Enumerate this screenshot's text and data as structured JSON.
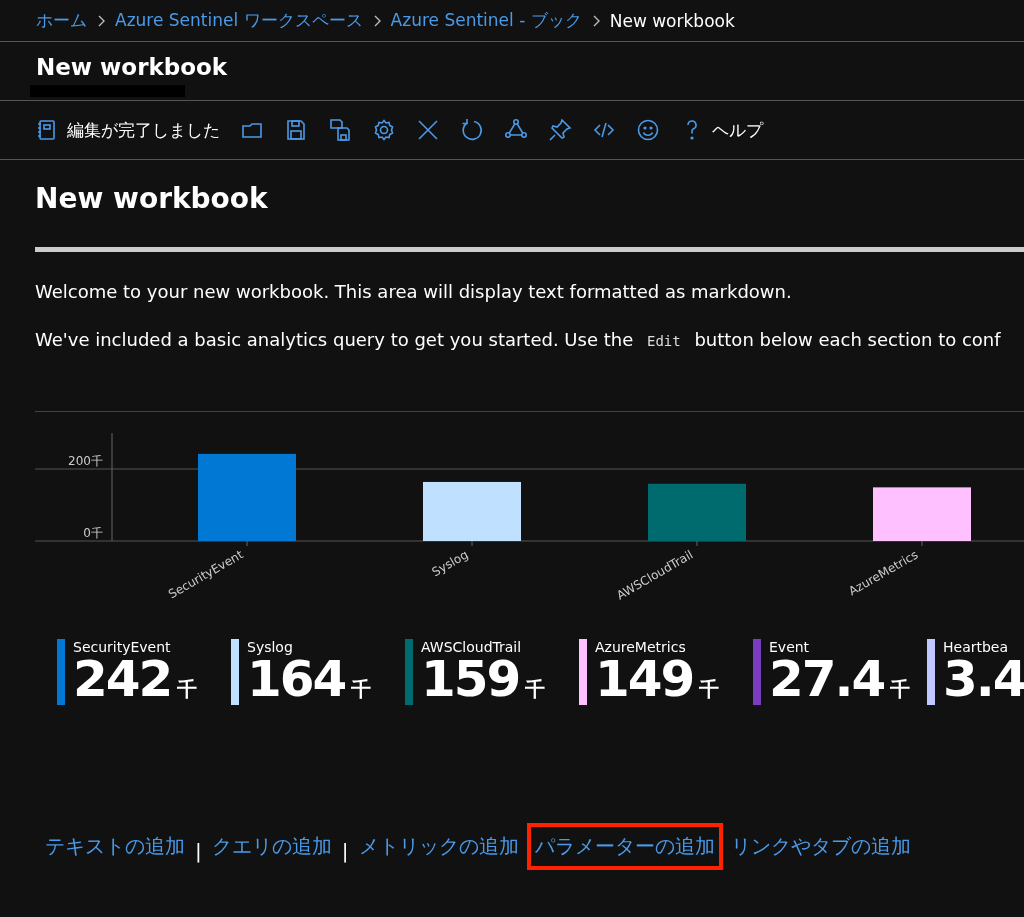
{
  "breadcrumb": [
    {
      "label": "ホーム",
      "kind": "link"
    },
    {
      "label": "Azure Sentinel ワークスペース",
      "kind": "link"
    },
    {
      "label": "Azure Sentinel - ブック",
      "kind": "link"
    },
    {
      "label": "New workbook",
      "kind": "current"
    }
  ],
  "blade_title": "New workbook",
  "toolbar": {
    "done_button": "編集が完了しました",
    "help_button": "ヘルプ"
  },
  "heading": "New workbook",
  "paragraphs": [
    {
      "parts": [
        {
          "kind": "text",
          "text": "Welcome to your new workbook. This area will display text formatted as markdown."
        }
      ]
    },
    {
      "parts": [
        {
          "kind": "text",
          "text": "We've included a basic analytics query to get you started. Use the "
        },
        {
          "kind": "code",
          "text": "Edit"
        },
        {
          "kind": "text",
          "text": " button below each section to conf"
        }
      ]
    }
  ],
  "chart": {
    "chart_data": {
      "type": "bar",
      "categories": [
        "SecurityEvent",
        "Syslog",
        "AWSCloudTrail",
        "AzureMetrics"
      ],
      "values": [
        242,
        164,
        159,
        149
      ],
      "colors": [
        "#0078d4",
        "#c0e0ff",
        "#006b6f",
        "#ffc0ff"
      ],
      "ylim": [
        0,
        300
      ],
      "yticks": [
        {
          "value": 0,
          "label": "0千"
        },
        {
          "value": 200,
          "label": "200千"
        }
      ]
    }
  },
  "tiles": [
    {
      "label": "SecurityEvent",
      "value": "242",
      "unit": "千",
      "color": "#0078d4"
    },
    {
      "label": "Syslog",
      "value": "164",
      "unit": "千",
      "color": "#c0e0ff"
    },
    {
      "label": "AWSCloudTrail",
      "value": "159",
      "unit": "千",
      "color": "#006b6f"
    },
    {
      "label": "AzureMetrics",
      "value": "149",
      "unit": "千",
      "color": "#ffc0ff"
    },
    {
      "label": "Event",
      "value": "27.4",
      "unit": "千",
      "color": "#7a3cc0"
    },
    {
      "label": "Heartbea",
      "value": "3.4",
      "color": "#c0c8ff"
    }
  ],
  "add_links": [
    {
      "kind": "link",
      "text": "テキストの追加",
      "highlighted": false
    },
    {
      "kind": "separator",
      "text": "|"
    },
    {
      "kind": "link",
      "text": "クエリの追加",
      "highlighted": false
    },
    {
      "kind": "separator",
      "text": "|"
    },
    {
      "kind": "link",
      "text": "メトリックの追加",
      "highlighted": false
    },
    {
      "kind": "link",
      "text": "パラメーターの追加",
      "highlighted": true
    },
    {
      "kind": "link",
      "text": "リンクやタブの追加",
      "highlighted": false
    }
  ]
}
